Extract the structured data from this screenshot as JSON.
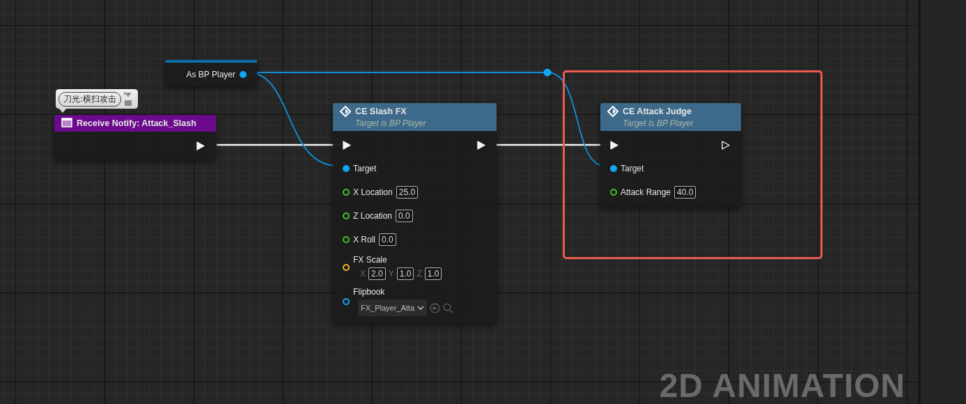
{
  "graph_label": "2D ANIMATION",
  "nodes": [
    {
      "kind": "variable",
      "title": "As BP Player",
      "output": {
        "connected": true,
        "color": "#12a6f0"
      }
    },
    {
      "kind": "event",
      "title": "Receive Notify: Attack_Slash",
      "comment": "刀光:横扫攻击",
      "exec_out": {
        "connected": true
      }
    },
    {
      "kind": "function",
      "title": "CE Slash FX",
      "subtitle": "Target is BP Player",
      "highlighted": false,
      "exec_in": {
        "connected": true
      },
      "exec_out": {
        "connected": true
      },
      "inputs": [
        {
          "kind": "object",
          "label": "Target",
          "color": "#12a6f0",
          "connected": true
        },
        {
          "kind": "value",
          "label": "X Location",
          "value": "25.0",
          "color": "#3cc81c",
          "connected": false
        },
        {
          "kind": "value",
          "label": "Z Location",
          "value": "0.0",
          "color": "#3cc81c",
          "connected": false
        },
        {
          "kind": "value",
          "label": "X Roll",
          "value": "0.0",
          "color": "#3cc81c",
          "connected": false
        },
        {
          "kind": "vector",
          "label": "FX Scale",
          "color": "#f0b420",
          "connected": false,
          "components": [
            {
              "axis": "X",
              "value": "2.0"
            },
            {
              "axis": "Y",
              "value": "1.0"
            },
            {
              "axis": "Z",
              "value": "1.0"
            }
          ]
        },
        {
          "kind": "asset",
          "label": "Flipbook",
          "value": "FX_Player_Atta",
          "color": "#12a6f0",
          "connected": false
        }
      ]
    },
    {
      "kind": "function",
      "title": "CE Attack Judge",
      "subtitle": "Target is BP Player",
      "highlighted": true,
      "exec_in": {
        "connected": true
      },
      "exec_out": {
        "connected": false
      },
      "inputs": [
        {
          "kind": "object",
          "label": "Target",
          "color": "#12a6f0",
          "connected": true
        },
        {
          "kind": "value",
          "label": "Attack Range",
          "value": "40.0",
          "color": "#3cc81c",
          "connected": false
        }
      ]
    }
  ]
}
